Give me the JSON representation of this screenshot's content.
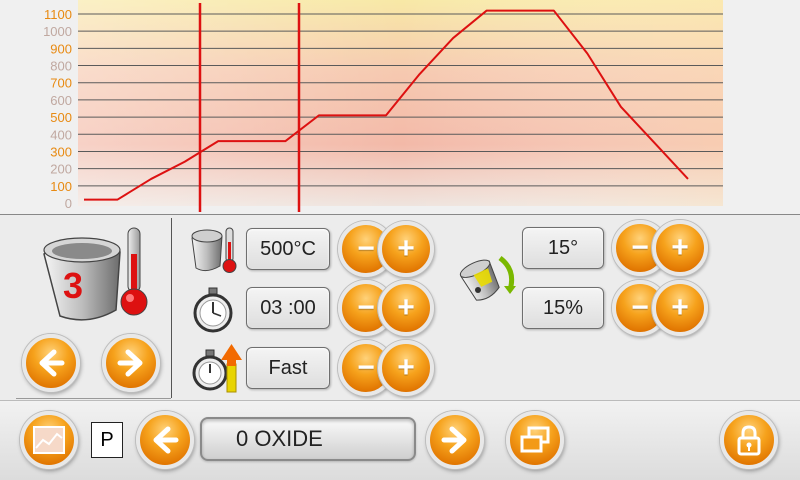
{
  "chart_data": {
    "type": "line",
    "ylim": [
      0,
      1100
    ],
    "yticks": [
      0,
      100,
      200,
      300,
      400,
      500,
      600,
      700,
      800,
      900,
      1000,
      1100
    ],
    "x": [
      0,
      1,
      2,
      3,
      4,
      5,
      6,
      7,
      8,
      9,
      10,
      11,
      12,
      13,
      14,
      15,
      16,
      17,
      18
    ],
    "values": [
      20,
      20,
      140,
      240,
      360,
      360,
      360,
      510,
      510,
      510,
      750,
      960,
      1120,
      1120,
      1120,
      870,
      560,
      350,
      140
    ],
    "series_color": "#dd1111",
    "grid": true
  },
  "panel": {
    "furnace_number": "3",
    "temperature_value": "500°C",
    "time_value": "03 :00",
    "rate_value": "Fast",
    "angle_value": "15°",
    "percent_value": "15%"
  },
  "bottom": {
    "p_label": "P",
    "program_name": "0 OXIDE"
  },
  "colors": {
    "accent_orange": "#f39a16",
    "curve_red": "#dd1111",
    "tick_orange": "#e88a12"
  },
  "icons": {
    "furnace": "furnace-thermometer-icon",
    "stopwatch": "stopwatch-icon",
    "rate": "stopwatch-rate-icon",
    "rotate": "rotate-pot-icon",
    "chart": "chart-icon",
    "window": "window-icon",
    "lock": "lock-icon"
  }
}
